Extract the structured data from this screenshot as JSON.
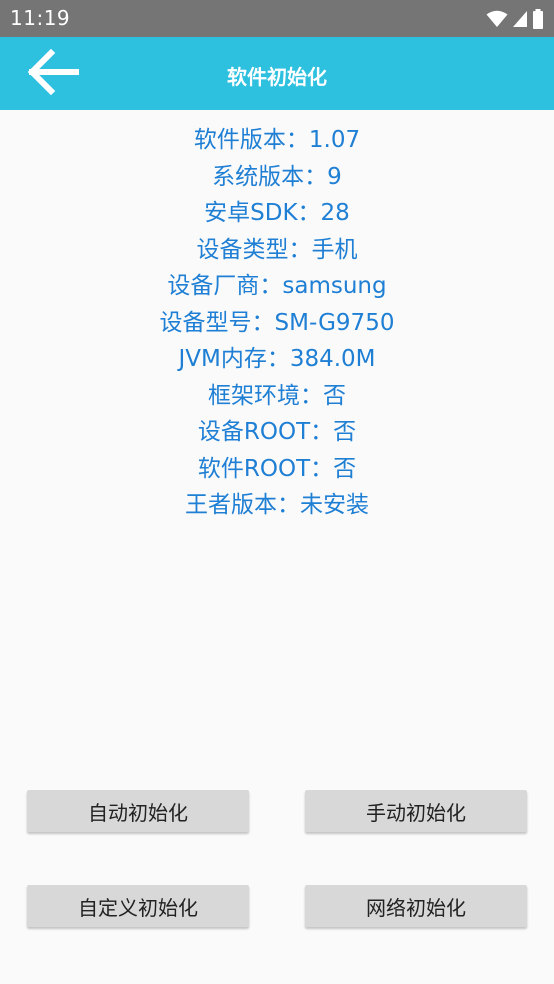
{
  "status_bar": {
    "time": "11:19",
    "icons": [
      "wifi-icon",
      "signal-icon",
      "battery-icon"
    ]
  },
  "app_bar": {
    "title": "软件初始化",
    "back_icon": "arrow-left-icon",
    "color": "#2ec0df"
  },
  "info": {
    "color": "#1e7fd4",
    "lines": [
      "软件版本：1.07",
      "系统版本：9",
      "安卓SDK：28",
      "设备类型：手机",
      "设备厂商：samsung",
      "设备型号：SM-G9750",
      "JVM内存：384.0M",
      "框架环境：否",
      "设备ROOT：否",
      "软件ROOT：否",
      "王者版本：未安装"
    ]
  },
  "buttons": {
    "auto_init": "自动初始化",
    "manual_init": "手动初始化",
    "custom_init": "自定义初始化",
    "network_init": "网络初始化"
  }
}
